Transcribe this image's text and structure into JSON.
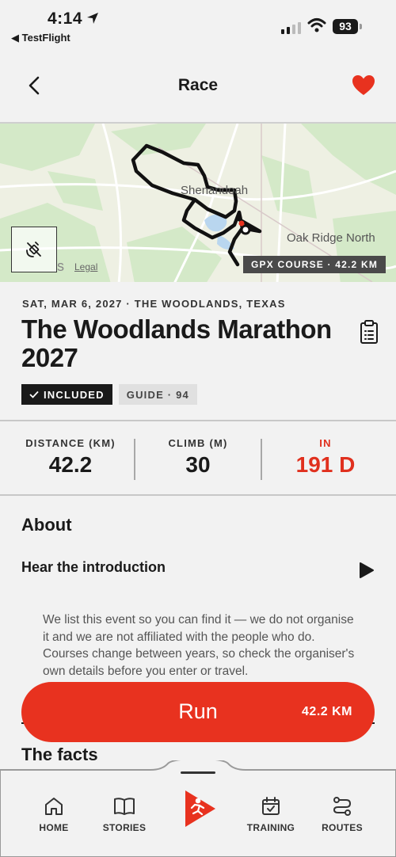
{
  "status_bar": {
    "time": "4:14",
    "back_app": "◀ TestFlight",
    "battery": "93"
  },
  "header": {
    "title": "Race"
  },
  "map": {
    "label_shenandoah": "Shenandoah",
    "label_oak_ridge": "Oak Ridge North",
    "legal": "Legal",
    "maps_fragment": "s",
    "gpx_badge": "GPX COURSE · 42.2 KM"
  },
  "event": {
    "meta": "SAT, MAR 6, 2027 · THE WOODLANDS, TEXAS",
    "title": "The Woodlands Marathon 2027",
    "badge_included": "INCLUDED",
    "badge_guide": "GUIDE · 94"
  },
  "stats": [
    {
      "label": "DISTANCE (KM)",
      "value": "42.2"
    },
    {
      "label": "CLIMB (M)",
      "value": "30"
    },
    {
      "label": "IN",
      "value": "191 D"
    }
  ],
  "about": {
    "title": "About",
    "intro": "Hear the introduction",
    "body": "We list this event so you can find it — we do not organise it and we are not affiliated with the people who do. Courses change between years, so check the organiser's own details before you enter or travel."
  },
  "run_button": {
    "label": "Run",
    "distance": "42.2 KM"
  },
  "facts": {
    "title": "The facts"
  },
  "tabbar": {
    "home": "HOME",
    "stories": "STORIES",
    "training": "TRAINING",
    "routes": "ROUTES"
  },
  "colors": {
    "accent": "#e8321f",
    "background": "#f2f2f2",
    "text": "#1a1a1a"
  }
}
